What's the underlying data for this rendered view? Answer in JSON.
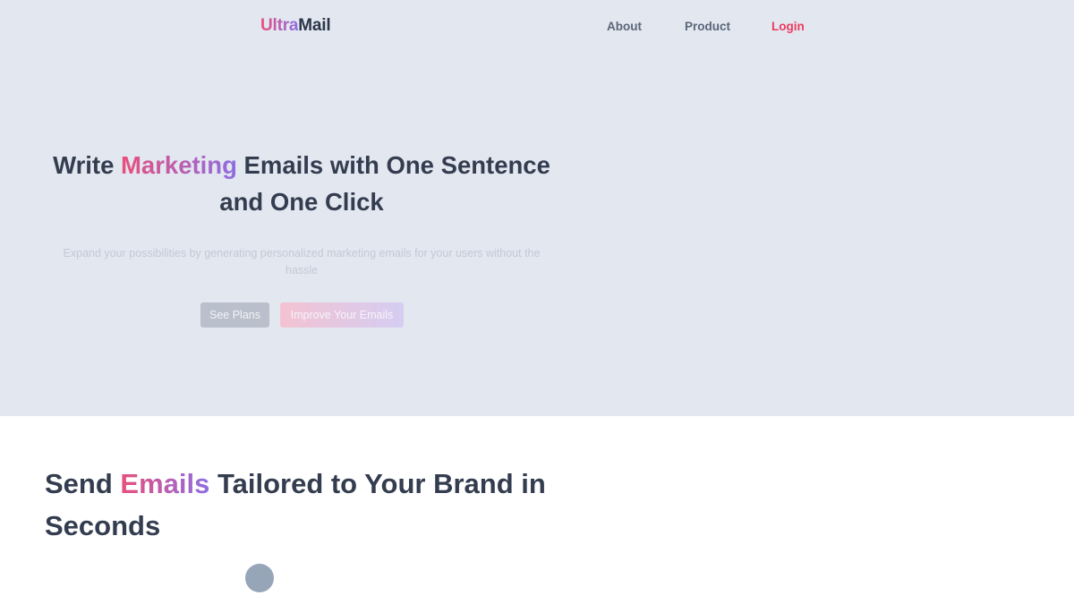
{
  "nav": {
    "brand_accent": "Ultra",
    "brand_rest": "Mail",
    "links": [
      {
        "label": "About"
      },
      {
        "label": "Product"
      },
      {
        "label": "Login"
      }
    ]
  },
  "hero": {
    "title_pre": "Write ",
    "title_highlight": "Marketing",
    "title_post": " Emails with One Sentence and One Click",
    "subtitle": "Expand your possibilities by generating personalized marketing emails for your users without the hassle",
    "buttons": {
      "plans": "See Plans",
      "improve": "Improve Your Emails"
    }
  },
  "section": {
    "title_pre": "Send ",
    "title_highlight": "Emails",
    "title_post": " Tailored to Your Brand in Seconds"
  },
  "colors": {
    "hero_background": "#e2e7f0",
    "heading_text": "#343d4f",
    "login_link": "#ec3b5f",
    "gradient_start": "#e94f7a",
    "gradient_end": "#8d6ee3",
    "indicator_dot": "#97a5b9"
  }
}
